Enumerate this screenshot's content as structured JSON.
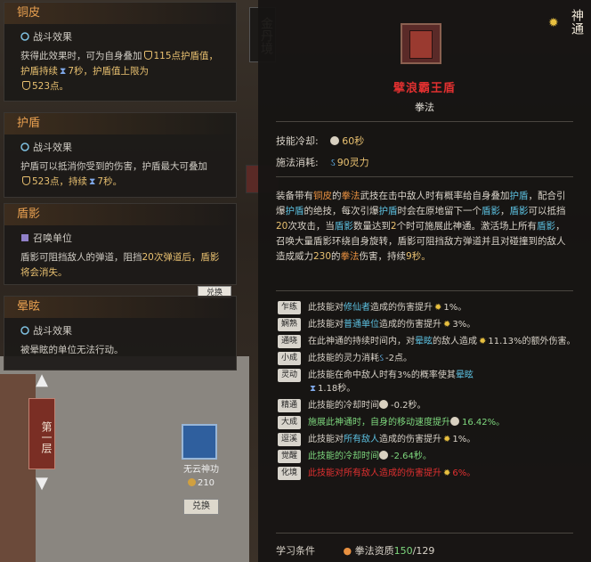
{
  "realm": "金丹境",
  "logo": "神通",
  "left_tips": [
    {
      "title": "铜皮",
      "subtitle": "战斗效果",
      "body_a": "获得此效果时，可为自身叠加",
      "body_b": "115点护盾值，护盾持续",
      "body_c": "7秒，护盾值上限为",
      "body_d": "523点。"
    },
    {
      "title": "护盾",
      "subtitle": "战斗效果",
      "body_a": "护盾可以抵消你受到的伤害，护盾最大可叠加",
      "body_b": "523点，持续",
      "body_c": "7秒。"
    },
    {
      "title": "盾影",
      "subtitle": "召唤单位",
      "body_a": "盾影可阻挡敌人的弹道，阻挡",
      "body_b": "20次弹道后，盾影将会消失。"
    },
    {
      "title": "晕眩",
      "subtitle": "战斗效果",
      "body_a": "被晕眩的单位无法行动。"
    }
  ],
  "level_nav": {
    "up": "▲",
    "label": "第一层",
    "down": "▼"
  },
  "item": {
    "name": "无云神功",
    "price": "210",
    "exchange": "兑换",
    "exchange_small": "兑换"
  },
  "skill": {
    "title": "擘浪霸王盾",
    "type": "拳法",
    "cooldown_label": "技能冷却:",
    "cooldown_value": "60秒",
    "cost_label": "施法消耗:",
    "cost_value": "90灵力",
    "desc_1": "装备带有",
    "desc_2": "铜皮",
    "desc_3": "的",
    "desc_4": "拳法",
    "desc_5": "武技在击中敌人时有概率给自身叠加",
    "desc_6": "护盾",
    "desc_7": "，配合引爆",
    "desc_8": "护盾",
    "desc_9": "的绝技，每次引爆",
    "desc_10": "护盾",
    "desc_11": "时会在原地留下一个",
    "desc_12": "盾影",
    "desc_13": "，",
    "desc_14": "盾影",
    "desc_15": "可以抵挡",
    "desc_16": "20",
    "desc_17": "次攻击，当",
    "desc_18": "盾影",
    "desc_19": "数量达到",
    "desc_20": "2",
    "desc_21": "个时可施展此神通。激活场上所有",
    "desc_22": "盾影",
    "desc_23": "，召唤大量盾影环绕自身旋转，盾影可阻挡敌方弹道并且对碰撞到的敌人造成威力",
    "desc_24": "230",
    "desc_25": "的",
    "desc_26": "拳法",
    "desc_27": "伤害，持续",
    "desc_28": "9秒。"
  },
  "mods": [
    {
      "tag": "乍练",
      "a": "此技能对",
      "b": "修仙者",
      "c": "造成的伤害提升",
      "d": "1%。",
      "style": ""
    },
    {
      "tag": "娴熟",
      "a": "此技能对",
      "b": "普通单位",
      "c": "造成的伤害提升",
      "d": "3%。",
      "style": ""
    },
    {
      "tag": "通晓",
      "a": "在此神通的持续时间内，对",
      "b": "晕眩",
      "c": "的敌人造成",
      "d": "11.13%的额外伤害。",
      "style": ""
    },
    {
      "tag": "小成",
      "a": "此技能的灵力消耗",
      "b": "",
      "c": "-2点。",
      "d": "",
      "style": ""
    },
    {
      "tag": "灵动",
      "a": "此技能在命中敌人时有",
      "b": "3%的概率使其",
      "c": "晕眩",
      "d": "1.18秒。",
      "style": ""
    },
    {
      "tag": "精通",
      "a": "此技能的冷却时间",
      "b": "",
      "c": "-0.2秒。",
      "d": "",
      "style": ""
    },
    {
      "tag": "大成",
      "a": "施展此神通时，自身的移动速度提升",
      "b": "",
      "c": "16.42%。",
      "d": "",
      "style": "green"
    },
    {
      "tag": "逗溪",
      "a": "此技能对",
      "b": "所有敌人",
      "c": "造成的伤害提升",
      "d": "1%。",
      "style": ""
    },
    {
      "tag": "觉醒",
      "a": "此技能的冷却时间",
      "b": "",
      "c": "-2.64秒。",
      "d": "",
      "style": "green"
    },
    {
      "tag": "化境",
      "a": "此技能对所有敌人造成的伤害提升",
      "b": "",
      "c": "6%。",
      "d": "",
      "style": "red"
    }
  ],
  "requirement": {
    "label": "学习条件",
    "stat": "拳法资质",
    "have": "150",
    "need": "/129"
  }
}
